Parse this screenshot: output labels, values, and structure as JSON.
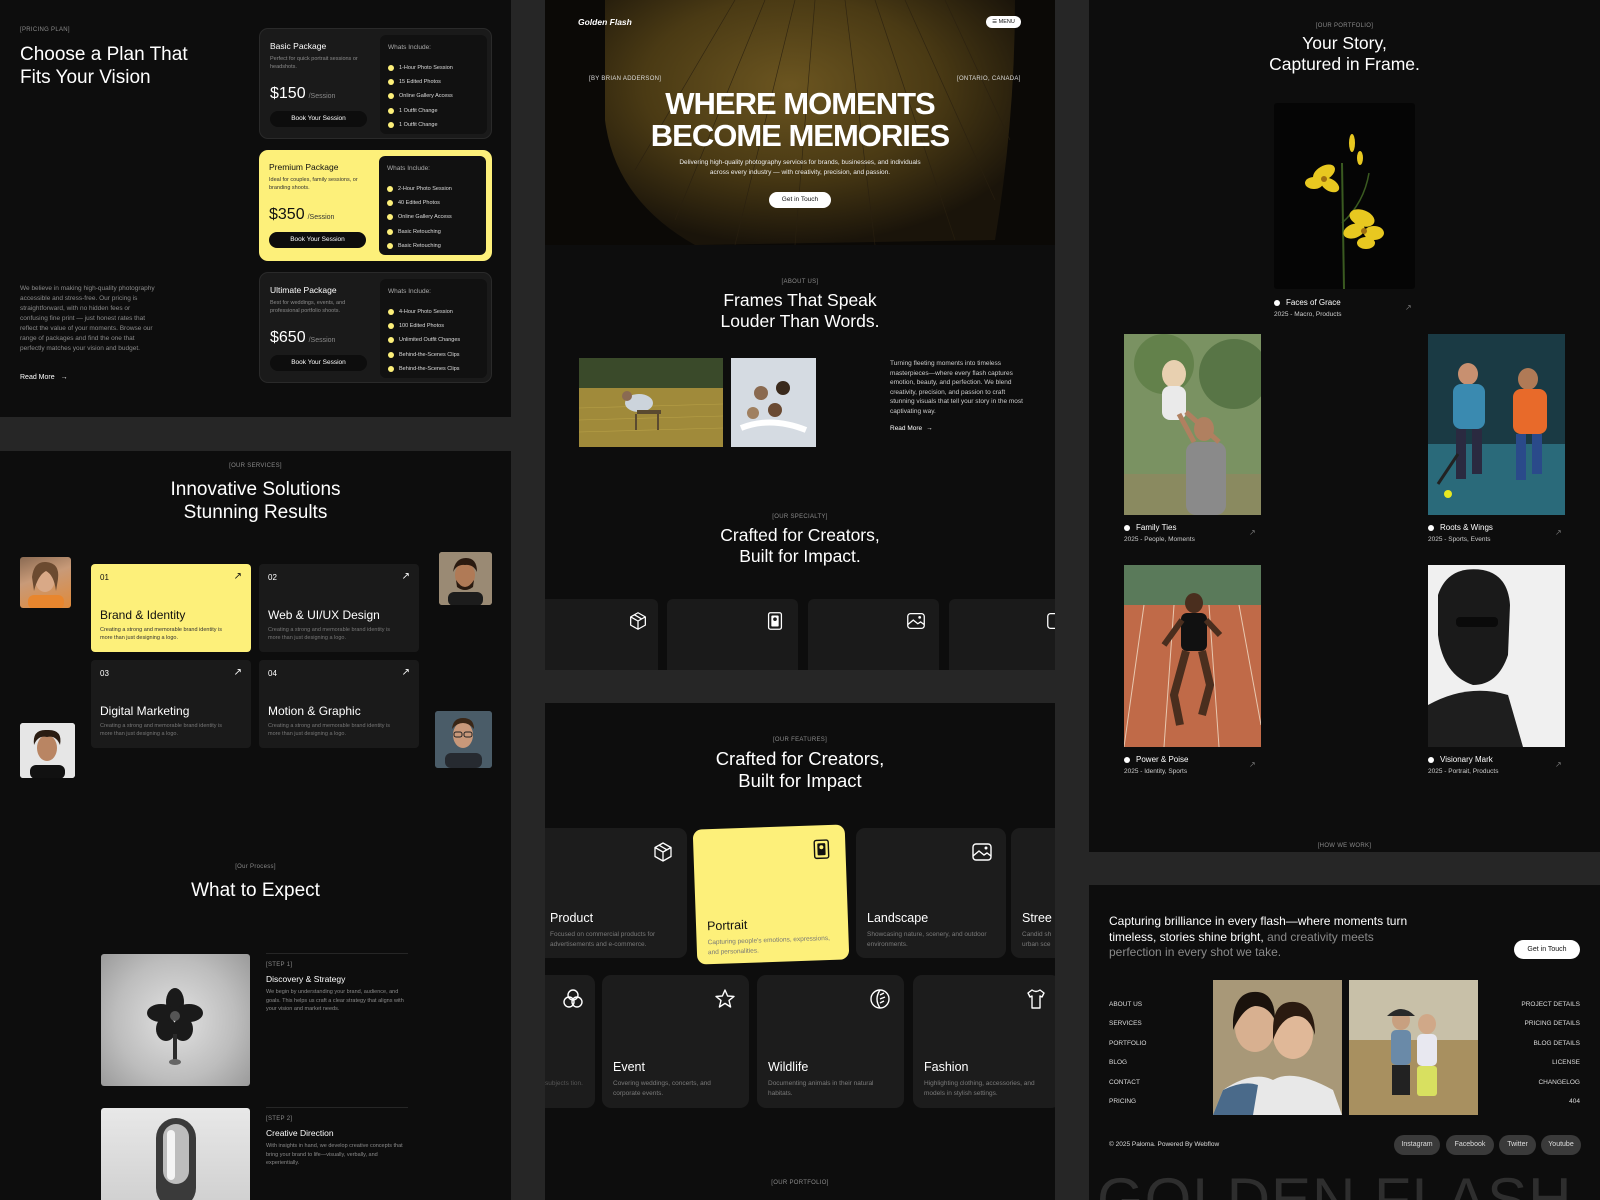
{
  "pricing": {
    "tag": "[PRICING PLAN]",
    "title_line1": "Choose a Plan That",
    "title_line2": "Fits Your Vision",
    "body": "We believe in making high-quality photography accessible and stress-free. Our pricing is straightforward, with no hidden fees or confusing fine print — just honest rates that reflect the value of your moments. Browse our range of packages and find the one that perfectly matches your vision and budget.",
    "read_more": "Read More",
    "includes_label": "Whats Include:",
    "per": "/Session",
    "button": "Book Your Session",
    "packages": [
      {
        "name": "Basic Package",
        "desc": "Perfect for quick portrait sessions or headshots.",
        "price": "$150",
        "items": [
          "1-Hour Photo Session",
          "15 Edited Photos",
          "Online Gallery Access",
          "1 Outfit Change",
          "1 Outfit Change"
        ]
      },
      {
        "name": "Premium Package",
        "desc": "Ideal for couples, family sessions, or branding shoots.",
        "price": "$350",
        "items": [
          "2-Hour Photo Session",
          "40 Edited Photos",
          "Online Gallery Access",
          "Basic Retouching",
          "Basic Retouching"
        ]
      },
      {
        "name": "Ultimate Package",
        "desc": "Best for weddings, events, and professional portfolio shoots.",
        "price": "$650",
        "items": [
          "4-Hour Photo Session",
          "100 Edited Photos",
          "Unlimited Outfit Changes",
          "Behind-the-Scenes Clips",
          "Behind-the-Scenes Clips"
        ]
      }
    ]
  },
  "services": {
    "tag": "[OUR SERVICES]",
    "title_line1": "Innovative Solutions",
    "title_line2": "Stunning Results",
    "arrow": "↗",
    "cards": [
      {
        "num": "01",
        "title": "Brand & Identity",
        "desc": "Creating a strong and memorable brand identity is more than just designing a logo."
      },
      {
        "num": "02",
        "title": "Web & UI/UX Design",
        "desc": "Creating a strong and memorable brand identity is more than just designing a logo."
      },
      {
        "num": "03",
        "title": "Digital Marketing",
        "desc": "Creating a strong and memorable brand identity is more than just designing a logo."
      },
      {
        "num": "04",
        "title": "Motion & Graphic",
        "desc": "Creating a strong and memorable brand identity is more than just designing a logo."
      }
    ]
  },
  "process": {
    "tag": "[Our Process]",
    "title": "What to Expect",
    "steps": [
      {
        "tag": "[STEP 1]",
        "title": "Discovery & Strategy",
        "desc": "We begin by understanding your brand, audience, and goals. This helps us craft a clear strategy that aligns with your vision and market needs."
      },
      {
        "tag": "[STEP 2]",
        "title": "Creative Direction",
        "desc": "With insights in hand, we develop creative concepts that bring your brand to life—visually, verbally, and experientially."
      }
    ]
  },
  "hero": {
    "brand": "Golden Flash",
    "menu": "MENU",
    "by": "[BY BRIAN ADDERSON]",
    "location": "[ONTARIO, CANADA]",
    "title_line1": "WHERE MOMENTS",
    "title_line2": "BECOME MEMORIES",
    "subtitle_line1": "Delivering high-quality photography services for brands, businesses, and individuals",
    "subtitle_line2": "across every industry — with creativity, precision, and passion.",
    "cta": "Get in Touch"
  },
  "about": {
    "tag": "[ABOUT US]",
    "title_line1": "Frames That Speak",
    "title_line2": "Louder Than Words.",
    "body": "Turning fleeting moments into timeless masterpieces—where every flash captures emotion, beauty, and perfection. We blend creativity, precision, and passion to craft stunning visuals that tell your story in the most captivating way.",
    "read_more": "Read More"
  },
  "specialty": {
    "tag": "[OUR SPECIALTY]",
    "title_line1": "Crafted for Creators,",
    "title_line2": "Built for Impact."
  },
  "features": {
    "tag": "[OUR FEATURES]",
    "title_line1": "Crafted for Creators,",
    "title_line2": "Built for Impact",
    "row1": [
      {
        "title": "Product",
        "desc": "Focused on commercial products for advertisements and e-commerce.",
        "icon": "box-icon"
      },
      {
        "title": "Portrait",
        "desc": "Capturing people's emotions, expressions, and personalities.",
        "icon": "portrait-icon"
      },
      {
        "title": "Landscape",
        "desc": "Showcasing nature, scenery, and outdoor environments.",
        "icon": "landscape-icon"
      },
      {
        "title": "Stree",
        "desc": "Candid sh urban sce",
        "icon": "street-icon"
      }
    ],
    "row2": [
      {
        "title": "",
        "desc": "subjects tion.",
        "icon": "circles-icon"
      },
      {
        "title": "Event",
        "desc": "Covering weddings, concerts, and corporate events.",
        "icon": "star-icon"
      },
      {
        "title": "Wildlife",
        "desc": "Documenting animals in their natural habitats.",
        "icon": "leaf-icon"
      },
      {
        "title": "Fashion",
        "desc": "Highlighting clothing, accessories, and models in stylish settings.",
        "icon": "shirt-icon"
      }
    ],
    "portfolio_tag": "[OUR PORTFOLIO]"
  },
  "portfolio": {
    "tag": "[OUR PORTFOLIO]",
    "title_line1": "Your Story,",
    "title_line2": "Captured in Frame.",
    "arrow": "↗",
    "items": [
      {
        "title": "Faces of Grace",
        "sub": "2025 - Macro, Products"
      },
      {
        "title": "Family Ties",
        "sub": "2025 - People, Moments"
      },
      {
        "title": "Roots & Wings",
        "sub": "2025 - Sports, Events"
      },
      {
        "title": "Power & Poise",
        "sub": "2025 - Identity, Sports"
      },
      {
        "title": "Visionary Mark",
        "sub": "2025 - Portrait, Products"
      }
    ],
    "how_tag": "[HOW WE WORK]"
  },
  "footer": {
    "tagline_white": "Capturing brilliance in every flash—where moments turn timeless, stories shine bright,",
    "tagline_gray": "and creativity meets perfection in every shot we take.",
    "cta": "Get in Touch",
    "nav_left": [
      "ABOUT US",
      "SERVICES",
      "PORTFOLIO",
      "BLOG",
      "CONTACT",
      "PRICING"
    ],
    "nav_right": [
      "PROJECT DETAILS",
      "PRICING DETAILS",
      "BLOG DETAILS",
      "LICENSE",
      "CHANGELOG",
      "404"
    ],
    "copyright": "© 2025 Paloma. Powered By Webflow",
    "socials": [
      "Instagram",
      "Facebook",
      "Twitter",
      "Youtube"
    ],
    "big_text": "GOLDEN FLASH"
  },
  "colors": {
    "accent": "#fdf07a",
    "bg": "#0d0d0d",
    "card": "#1a1a1a",
    "gutter": "#262626"
  }
}
